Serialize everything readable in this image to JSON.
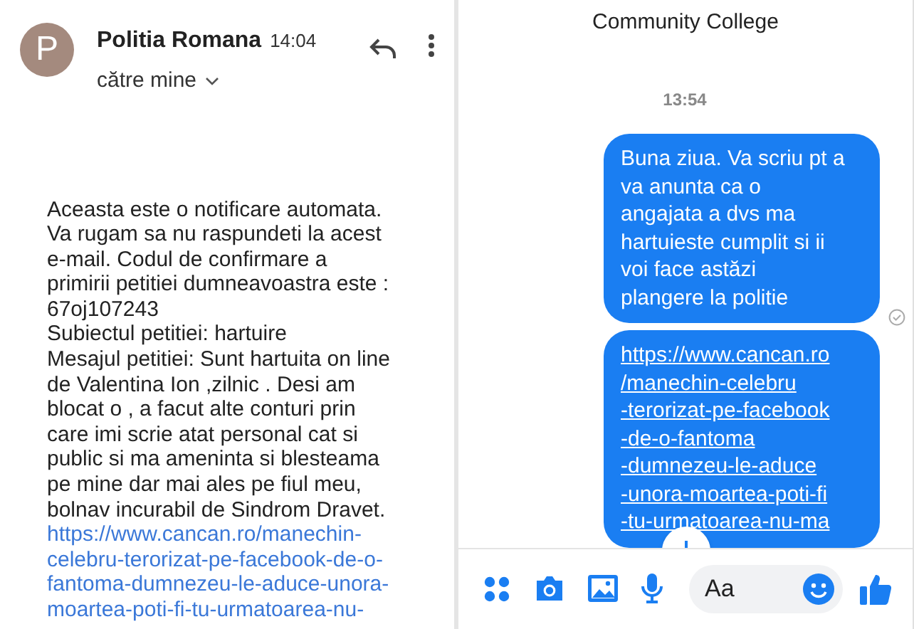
{
  "email": {
    "avatar": "P",
    "sender": "Politia Romana",
    "time": "14:04",
    "recipient": "către mine",
    "body": [
      {
        "kind": "text",
        "lines": [
          "Aceasta este o notificare automata.",
          "Va rugam sa nu raspundeti la acest",
          "e-mail. Codul de confirmare a",
          "primirii petitiei dumneavoastra este :",
          "67oj107243"
        ]
      },
      {
        "kind": "text",
        "lines": [
          "Subiectul petitiei: hartuire"
        ]
      },
      {
        "kind": "text",
        "lines": [
          "Mesajul petitiei: Sunt hartuita on line",
          "de Valentina Ion ,zilnic . Desi am",
          "blocat o , a facut alte conturi prin",
          "care imi scrie atat personal cat si",
          "public si ma ameninta si blesteama",
          "pe mine dar mai ales pe fiul meu,",
          "bolnav incurabil de Sindrom Dravet."
        ]
      },
      {
        "kind": "link",
        "lines": [
          "https://www.cancan.ro/manechin-",
          "celebru-terorizat-pe-facebook-de-o-",
          "fantoma-dumnezeu-le-aduce-unora-",
          "moartea-poti-fi-tu-urmatoarea-nu-"
        ]
      }
    ]
  },
  "chat": {
    "title": "Community College",
    "timestamp": "13:54",
    "messages": [
      {
        "kind": "text",
        "lines": [
          "Buna ziua. Va scriu pt a",
          "va anunta ca o",
          "angajata a dvs ma",
          "hartuieste cumplit si ii",
          "voi face astăzi",
          "plangere la politie"
        ],
        "seen": true
      },
      {
        "kind": "link",
        "lines": [
          "https://www.cancan.ro",
          "/manechin-celebru",
          "-terorizat-pe-facebook",
          "-de-o-fantoma",
          "-dumnezeu-le-aduce",
          "-unora-moartea-poti-fi",
          "-tu-urmatoarea-nu-ma"
        ]
      }
    ],
    "composer": {
      "placeholder": "Aa"
    }
  }
}
